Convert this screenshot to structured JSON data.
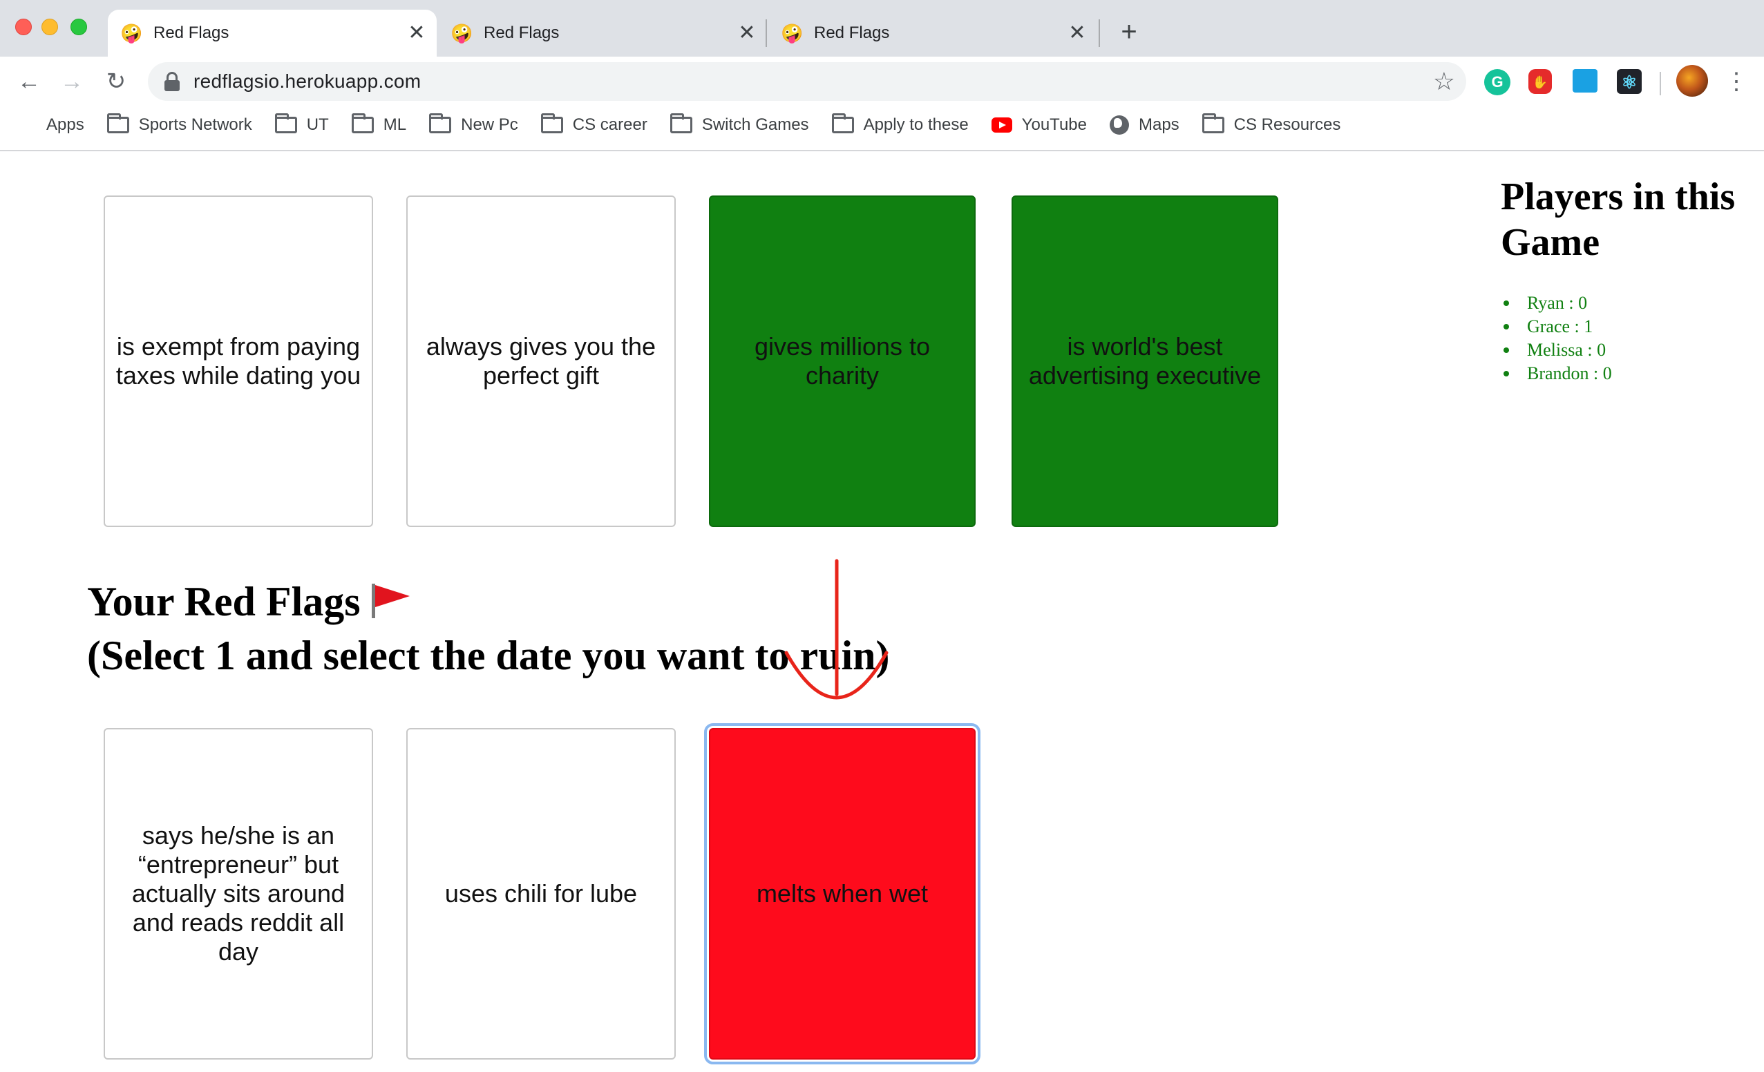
{
  "browser": {
    "tabs": [
      {
        "title": "Red Flags",
        "favicon": "🤪",
        "close": "✕"
      },
      {
        "title": "Red Flags",
        "favicon": "🤪",
        "close": "✕"
      },
      {
        "title": "Red Flags",
        "favicon": "🤪",
        "close": "✕"
      }
    ],
    "new_tab": "+",
    "nav": {
      "back": "←",
      "forward": "→",
      "reload": "↻"
    },
    "url": "redflagsio.herokuapp.com",
    "star": "☆",
    "extensions": {
      "grammarly": "G",
      "adblock": "✋",
      "react": "⚛"
    },
    "menu": "⋮",
    "bookmarks": [
      {
        "label": "Apps",
        "icon": "apps-grid-icon"
      },
      {
        "label": "Sports Network",
        "icon": "folder-icon"
      },
      {
        "label": "UT",
        "icon": "folder-icon"
      },
      {
        "label": "ML",
        "icon": "folder-icon"
      },
      {
        "label": "New Pc",
        "icon": "folder-icon"
      },
      {
        "label": "CS career",
        "icon": "folder-icon"
      },
      {
        "label": "Switch Games",
        "icon": "folder-icon"
      },
      {
        "label": "Apply to these",
        "icon": "folder-icon"
      },
      {
        "label": "YouTube",
        "icon": "youtube-icon"
      },
      {
        "label": "Maps",
        "icon": "globe-icon"
      },
      {
        "label": "CS Resources",
        "icon": "folder-icon"
      }
    ]
  },
  "game": {
    "date_cards": [
      {
        "text": "is exempt from paying taxes while dating you",
        "color": "#ffffff"
      },
      {
        "text": "always gives you the perfect gift",
        "color": "#ffffff"
      },
      {
        "text": "gives millions to charity",
        "color": "#108011"
      },
      {
        "text": "is world's best advertising executive",
        "color": "#108011"
      }
    ],
    "red_flags_heading": "Your Red Flags",
    "red_flags_flag": "red-triangular-flag-icon",
    "red_flags_instruction": "(Select 1 and select the date you want to ruin)",
    "red_flag_cards": [
      {
        "text": "says he/she is an “entrepreneur” but actually sits around and reads reddit all day",
        "color": "#ffffff"
      },
      {
        "text": "uses chili for lube",
        "color": "#ffffff"
      },
      {
        "text": "melts when wet",
        "color": "#fe0b1c",
        "selected": true
      }
    ],
    "players_title": "Players in this Game",
    "players": [
      {
        "label": "Ryan : 0"
      },
      {
        "label": "Grace : 1"
      },
      {
        "label": "Melissa : 0"
      },
      {
        "label": "Brandon : 0"
      }
    ],
    "annotation_color": "#e8241a"
  }
}
